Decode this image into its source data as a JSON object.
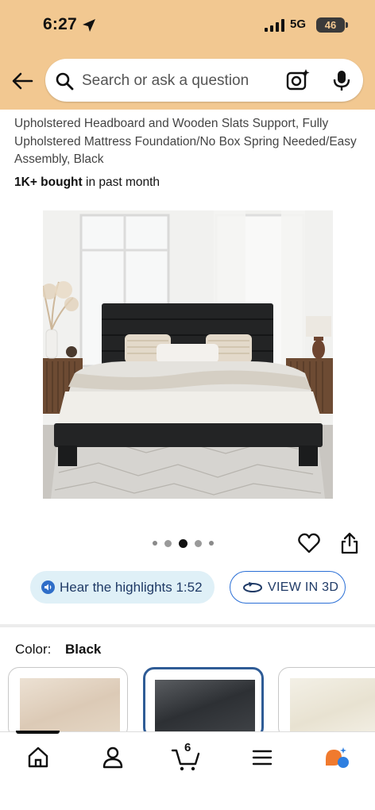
{
  "status_bar": {
    "time": "6:27",
    "network": "5G",
    "battery": "46"
  },
  "search": {
    "placeholder": "Search or ask a question"
  },
  "product": {
    "title": "Upholstered Headboard and Wooden Slats Support, Fully Upholstered Mattress Foundation/No Box Spring Needed/Easy Assembly, Black",
    "bought_bold": "1K+ bought",
    "bought_rest": " in past month",
    "image_alt": "Black upholstered platform bed with channel-tufted headboard in a bright bedroom",
    "carousel": {
      "total": 5,
      "active_index": 2
    }
  },
  "actions": {
    "hear_label": "Hear the highlights 1:52",
    "view3d_label": "VIEW IN 3D"
  },
  "color": {
    "label": "Color:",
    "selected": "Black",
    "swatches": [
      {
        "name": "Beige",
        "color": "#e3d4c2"
      },
      {
        "name": "Black",
        "color": "#3a3d41"
      },
      {
        "name": "Cream",
        "color": "#efe9dc"
      }
    ]
  },
  "bottom_nav": {
    "items": [
      "home-icon",
      "account-icon",
      "cart-icon",
      "menu-icon",
      "rufus-ai-icon"
    ],
    "cart_count": "6"
  },
  "colors": {
    "header_bg": "#f2c891",
    "accent_blue": "#2a6fd6",
    "selected_border": "#2f5c96"
  }
}
